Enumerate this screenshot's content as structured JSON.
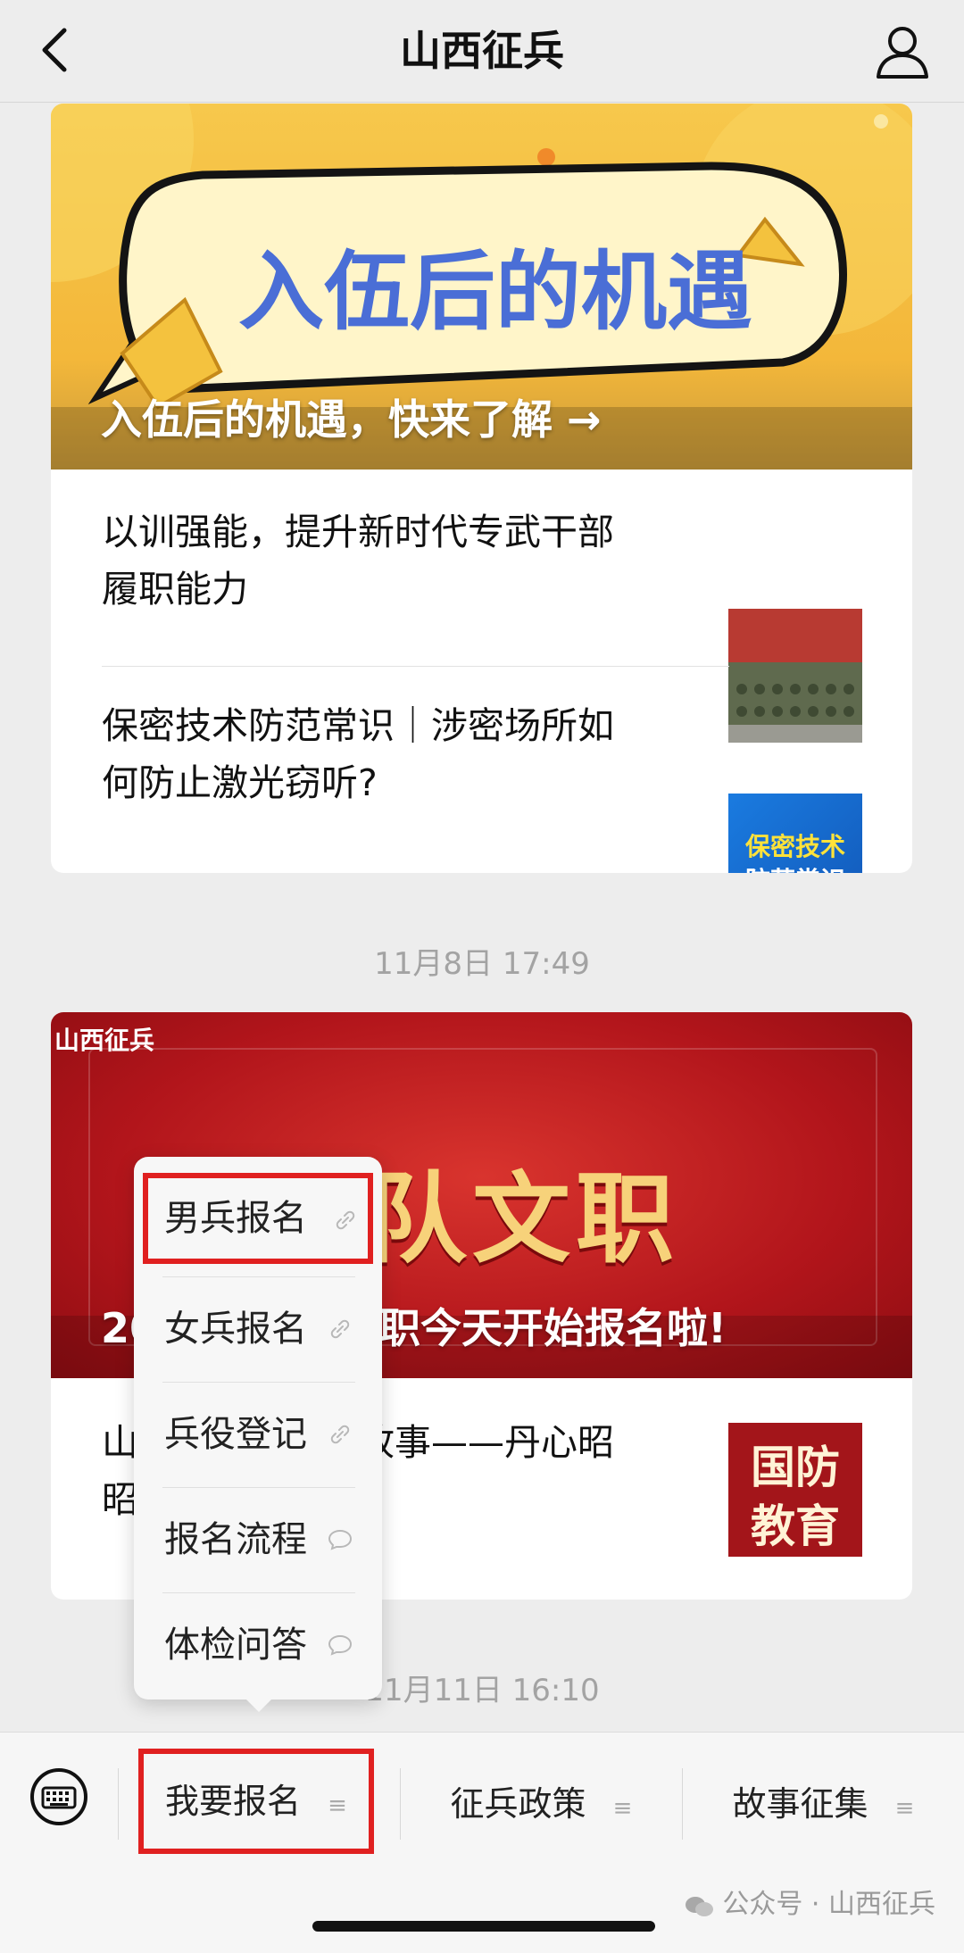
{
  "nav": {
    "title": "山西征兵"
  },
  "card1": {
    "banner_image_text": "入伍后的机遇",
    "banner_caption": "入伍后的机遇，快来了解 →",
    "articles": [
      {
        "title_line1": "以训强能，提升新时代专武干部",
        "title_line2": "履职能力"
      },
      {
        "title_line1": "保密技术防范常识｜涉密场所如",
        "title_line2": "何防止激光窃听?",
        "thumb_text_1": "保密技术",
        "thumb_text_2": "防范常识"
      }
    ]
  },
  "timestamp1": "11月8日 17:49",
  "card2": {
    "logo": "山西征兵",
    "banner_image_text": "军队文职",
    "banner_caption": "2025年军队文职今天开始报名啦!",
    "article_line1": "山西征兵｜国防故事——丹心昭",
    "article_line2": "昭",
    "thumb_text_1": "国防",
    "thumb_text_2": "教育"
  },
  "timestamp2": "11月11日 16:10",
  "popup": {
    "items": [
      {
        "label": "男兵报名",
        "icon": "link-icon"
      },
      {
        "label": "女兵报名",
        "icon": "link-icon"
      },
      {
        "label": "兵役登记",
        "icon": "link-icon"
      },
      {
        "label": "报名流程",
        "icon": "chat-icon"
      },
      {
        "label": "体检问答",
        "icon": "chat-icon"
      }
    ]
  },
  "menu": {
    "items": [
      {
        "label": "我要报名"
      },
      {
        "label": "征兵政策"
      },
      {
        "label": "故事征集"
      }
    ]
  },
  "watermark": "公众号 · 山西征兵",
  "colors": {
    "highlight": "#e02020",
    "banner1": "#f5c64a",
    "banner2": "#b8171c"
  }
}
